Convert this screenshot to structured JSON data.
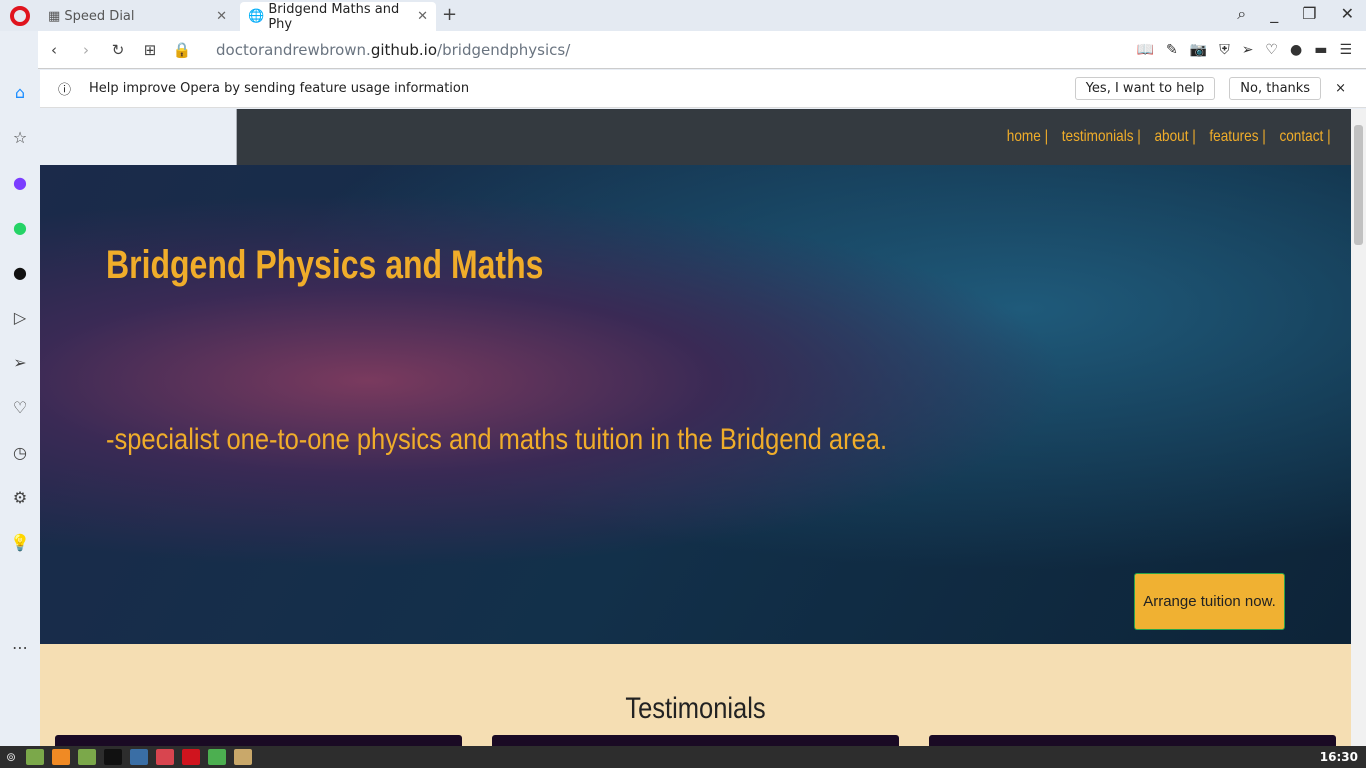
{
  "browser": {
    "tabs": [
      {
        "label": "Speed Dial"
      },
      {
        "label": "Bridgend Maths and Phy"
      }
    ],
    "url": {
      "host_prefix": "doctorandrewbrown.",
      "host": "github.io",
      "path": "/bridgendphysics/"
    }
  },
  "infobar": {
    "message": "Help improve Opera by sending feature usage information",
    "yes": "Yes, I want to help",
    "no": "No, thanks"
  },
  "site": {
    "nav": [
      "home |",
      "testimonials |",
      "about |",
      "features |",
      "contact |"
    ],
    "title": "Bridgend Physics and Maths",
    "tagline": "-specialist one-to-one physics and maths tuition in the Bridgend area.",
    "cta": "Arrange tuition now.",
    "testimonials_heading": "Testimonials"
  },
  "taskbar": {
    "clock": "16:30"
  },
  "colors": {
    "accent": "#f0ad2a",
    "nav_bg": "#343a40",
    "testimonial_bg": "#f5deb3"
  }
}
